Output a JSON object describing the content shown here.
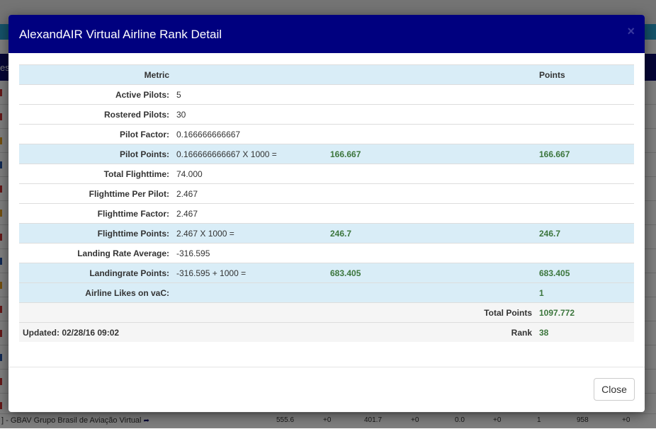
{
  "background": {
    "nav_fragment": "es",
    "last_row": {
      "name": "GBAV Grupo Brasil de Aviação Virtual",
      "cells": [
        "555.6",
        "+0",
        "401.7",
        "+0",
        "0.0",
        "+0",
        "1",
        "958",
        "+0"
      ]
    }
  },
  "modal": {
    "title": "AlexandAIR Virtual Airline Rank Detail",
    "close_x": "×",
    "header_row": {
      "metric": "Metric",
      "points": "Points"
    },
    "rows": [
      {
        "label": "Active Pilots:",
        "value": "5",
        "calc": "",
        "points": ""
      },
      {
        "label": "Rostered Pilots:",
        "value": "30",
        "calc": "",
        "points": ""
      },
      {
        "label": "Pilot Factor:",
        "value": "0.166666666667",
        "calc": "",
        "points": ""
      },
      {
        "label": "Pilot Points:",
        "value": "0.166666666667 X 1000 =",
        "calc": "166.667",
        "points": "166.667"
      },
      {
        "label": "Total Flighttime:",
        "value": "74.000",
        "calc": "",
        "points": ""
      },
      {
        "label": "Flighttime Per Pilot:",
        "value": "2.467",
        "calc": "",
        "points": ""
      },
      {
        "label": "Flighttime Factor:",
        "value": "2.467",
        "calc": "",
        "points": ""
      },
      {
        "label": "Flighttime Points:",
        "value": "2.467 X 1000 =",
        "calc": "246.7",
        "points": "246.7"
      },
      {
        "label": "Landing Rate Average:",
        "value": "-316.595",
        "calc": "",
        "points": ""
      },
      {
        "label": "Landingrate Points:",
        "value": "-316.595 + 1000 =",
        "calc": "683.405",
        "points": "683.405"
      },
      {
        "label": "Airline Likes on vaC:",
        "value": "",
        "calc": "",
        "points": "1"
      }
    ],
    "total": {
      "label": "Total Points",
      "value": "1097.772"
    },
    "footer_row": {
      "updated": "Updated: 02/28/16 09:02",
      "rank_label": "Rank",
      "rank_value": "38"
    },
    "close_button": "Close"
  }
}
